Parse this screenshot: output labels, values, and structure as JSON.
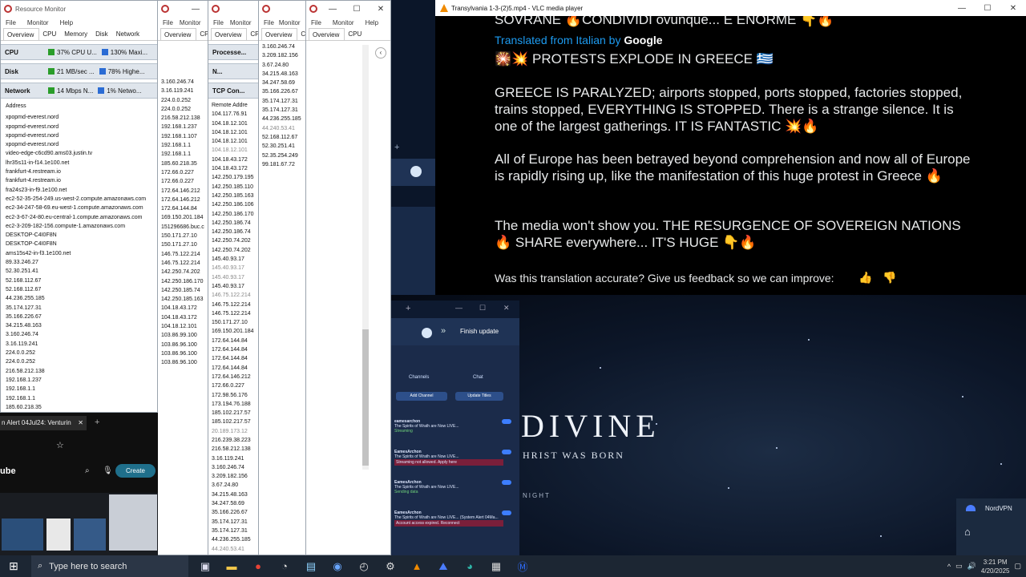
{
  "resmon": {
    "title": "Resource Monitor",
    "menu": [
      "File",
      "Monitor",
      "Help"
    ],
    "tabs": [
      "Overview",
      "CPU",
      "Memory",
      "Disk",
      "Network"
    ],
    "cpu": {
      "label": "CPU",
      "usage": "37% CPU U...",
      "freq": "130% Maxi..."
    },
    "disk": {
      "label": "Disk",
      "io": "21 MB/sec ...",
      "active": "78% Highe..."
    },
    "network": {
      "label": "Network",
      "io": "14 Mbps N...",
      "util": "1% Netwo..."
    },
    "col_header": "Address",
    "addresses": [
      "xpopmd-everest.nord",
      "xpopmd-everest.nord",
      "xpopmd-everest.nord",
      "xpopmd-everest.nord",
      "video-edge-c6cd90.ams03.justin.tv",
      "lhr35s11-in-f14.1e100.net",
      "frankfurt-4.restream.io",
      "frankfurt-4.restream.io",
      "fra24s23-in-f9.1e100.net",
      "ec2-52-35-254-249.us-west-2.compute.amazonaws.com",
      "ec2-34-247-58-69.eu-west-1.compute.amazonaws.com",
      "ec2-3-67-24-80.eu-central-1.compute.amazonaws.com",
      "ec2-3-209-182-156.compute-1.amazonaws.com",
      "DESKTOP-C4I0F8N",
      "DESKTOP-C4I0F8N",
      "ams15s42-in-f3.1e100.net",
      "89.33.246.27",
      "52.30.251.41",
      "52.168.112.67",
      "52.168.112.67",
      "44.236.255.185",
      "35.174.127.31",
      "35.166.226.67",
      "34.215.48.163",
      "3.160.246.74",
      "3.16.119.241",
      "224.0.0.252",
      "224.0.0.252",
      "216.58.212.138",
      "192.168.1.237",
      "192.168.1.1",
      "192.168.1.1",
      "185.60.218.35"
    ]
  },
  "win2": {
    "menu": [
      "File",
      "Monitor"
    ],
    "tabs": [
      "Overview",
      "CPU"
    ],
    "ips": [
      "3.160.246.74",
      "3.16.119.241",
      "224.0.0.252",
      "224.0.0.252",
      "216.58.212.138",
      "192.168.1.237",
      "192.168.1.107",
      "192.168.1.1",
      "192.168.1.1",
      "185.60.218.35",
      "172.66.0.227",
      "172.66.0.227",
      "172.64.146.212",
      "172.64.146.212",
      "172.64.144.84",
      "169.150.201.184",
      "151296686.buc.c",
      "150.171.27.10",
      "150.171.27.10",
      "146.75.122.214",
      "146.75.122.214",
      "142.250.74.202",
      "142.250.186.170",
      "142.250.185.74",
      "142.250.185.163",
      "104.18.43.172",
      "104.18.43.172",
      "104.18.12.101",
      "103.86.99.100",
      "103.86.96.100",
      "103.86.96.100",
      "103.86.96.100"
    ]
  },
  "win3": {
    "menu": [
      "File",
      "Monitor"
    ],
    "tabs": [
      "Overview",
      "CPU"
    ],
    "section1": "Processe...",
    "section2": "N...",
    "section3": "TCP Con...",
    "col_header": "Remote Addre",
    "ips": [
      "104.117.76.91",
      "104.18.12.101",
      "104.18.12.101",
      "104.18.12.101",
      "104.18.12.101",
      "104.18.43.172",
      "104.18.43.172",
      "142.250.179.195",
      "142.250.185.110",
      "142.250.185.163",
      "142.250.186.106",
      "142.250.186.170",
      "142.250.186.74",
      "142.250.186.74",
      "142.250.74.202",
      "142.250.74.202",
      "145.40.93.17",
      "145.40.93.17",
      "145.40.93.17",
      "145.40.93.17",
      "146.75.122.214",
      "146.75.122.214",
      "146.75.122.214",
      "150.171.27.10",
      "169.150.201.184",
      "172.64.144.84",
      "172.64.144.84",
      "172.64.144.84",
      "172.64.144.84",
      "172.64.146.212",
      "172.66.0.227",
      "172.98.56.176",
      "173.194.76.188",
      "185.102.217.57",
      "185.102.217.57",
      "20.189.173.12",
      "216.239.38.223",
      "216.58.212.138",
      "3.16.119.241",
      "3.160.246.74",
      "3.209.182.156",
      "3.67.24.80",
      "34.215.48.163",
      "34.247.58.69",
      "35.166.226.67",
      "35.174.127.31",
      "35.174.127.31",
      "44.236.255.185",
      "44.240.53.41"
    ]
  },
  "win4": {
    "menu": [
      "File",
      "Monitor"
    ],
    "tabs": [
      "Overview",
      "CPU"
    ],
    "ips": [
      "3.160.246.74",
      "3.209.182.156",
      "3.67.24.80",
      "34.215.48.163",
      "34.247.58.69",
      "35.166.226.67",
      "35.174.127.31",
      "35.174.127.31",
      "44.236.255.185",
      "44.240.53.41",
      "52.168.112.67",
      "52.30.251.41",
      "52.35.254.249",
      "99.181.67.72"
    ]
  },
  "win5": {
    "menu": [
      "File",
      "Monitor",
      "Help"
    ],
    "tabs": [
      "Overview",
      "CPU"
    ]
  },
  "vlc": {
    "title": "Transylvania 1-3-(2)5.mp4 - VLC media player",
    "top_line": "SOVRANE 🔥CONDIVIDI ovunque... È ENORME 👇🔥",
    "translated": "Translated from Italian by",
    "google": "Google",
    "headline": "🎇💥 PROTESTS EXPLODE IN GREECE 🇬🇷",
    "para1": "GREECE IS PARALYZED; airports stopped, ports stopped, factories stopped, trains stopped, EVERYTHING IS STOPPED. There is a strange silence. It is one of the largest gatherings. IT IS FANTASTIC 💥🔥",
    "para2": "All of Europe has been betrayed beyond comprehension and now all of Europe is rapidly rising up, like the manifestation of this huge protest in Greece 🔥",
    "para3": "The media won't show you. THE RESURGENCE OF SOVEREIGN NATIONS 🔥 SHARE everywhere... IT'S HUGE 👇🔥",
    "feedback": "Was this translation accurate? Give us feedback so we can improve:"
  },
  "space": {
    "title": "DIVINE",
    "subtitle": "HRIST WAS BORN",
    "small": "NIGHT"
  },
  "browser": {
    "finish_update": "Finish update",
    "channels": "Channels",
    "chat": "Chat",
    "add_channel": "Add Channel",
    "update_titles": "Update Titles",
    "rows": [
      {
        "name": "eamesarchon",
        "text": "The Spirits of Wrath are Now LIVE...",
        "status": "Streaming"
      },
      {
        "name": "EamesArchon",
        "text": "The Spirits of Wrath are Now LIVE...",
        "status": "Streaming not allowed. Apply here"
      },
      {
        "name": "EamesArchon",
        "text": "The Spirits of Wrath are Now LIVE...",
        "status": "Sending data"
      },
      {
        "name": "EamesArchon",
        "text": "The Spirits of Wrath are Now LIVE... (System Alert 04Ma...",
        "status": "Account access expired. Reconnect"
      }
    ]
  },
  "youtube": {
    "tab_title": "n Alert 04Jul24: Venturin",
    "logo": "ube",
    "create": "Create"
  },
  "nordvpn": {
    "label": "NordVPN"
  },
  "taskbar": {
    "search": "Type here to search",
    "time": "3:21 PM",
    "date": "4/20/2025"
  }
}
